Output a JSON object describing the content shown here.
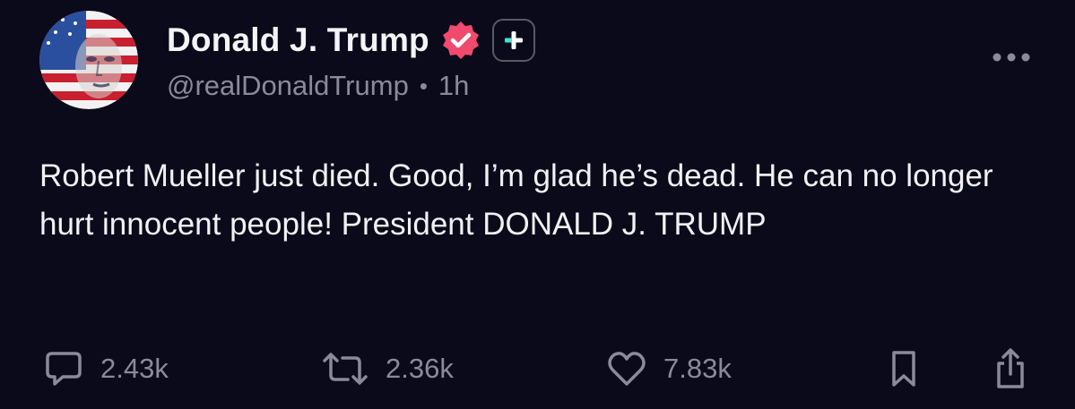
{
  "author": {
    "display_name": "Donald J. Trump",
    "handle": "@realDonaldTrump",
    "separator": "•",
    "time_ago": "1h",
    "verified_icon": "verified-badge-icon",
    "badge_icon": "plus-icon"
  },
  "post": {
    "text": "Robert Mueller just died. Good, I’m glad he’s dead. He can no longer hurt innocent people! President DONALD J. TRUMP"
  },
  "actions": {
    "replies": "2.43k",
    "reposts": "2.36k",
    "likes": "7.83k"
  },
  "colors": {
    "background": "#0b0a1a",
    "text": "#f1f1f5",
    "muted": "#8a8a99",
    "verified": "#f04a6e",
    "badge_plus": "#3ee6c8"
  }
}
